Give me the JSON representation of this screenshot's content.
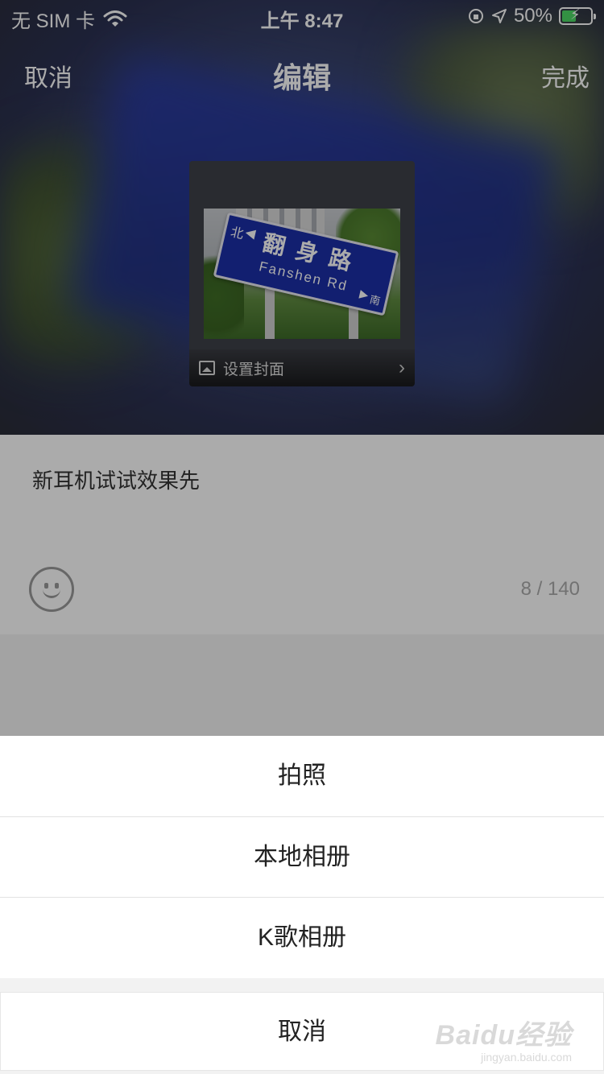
{
  "status_bar": {
    "carrier": "无 SIM 卡",
    "time": "上午 8:47",
    "battery": "50%",
    "battery_level": 0.5
  },
  "nav": {
    "cancel_label": "取消",
    "title": "编辑",
    "done_label": "完成"
  },
  "cover": {
    "set_cover_label": "设置封面",
    "sign": {
      "north": "北",
      "road_cn": "翻身路",
      "road_en": "Fanshen Rd",
      "south": "南"
    }
  },
  "editor": {
    "text": "新耳机试试效果先",
    "counter": "8 / 140"
  },
  "action_sheet": {
    "options": [
      {
        "label": "拍照"
      },
      {
        "label": "本地相册"
      },
      {
        "label": "K歌相册"
      }
    ],
    "cancel_label": "取消"
  },
  "watermark": {
    "brand": "Baidu经验",
    "url": "jingyan.baidu.com"
  },
  "colors": {
    "sign_blue": "#1c2fa8",
    "battery_green": "#4cd964"
  }
}
